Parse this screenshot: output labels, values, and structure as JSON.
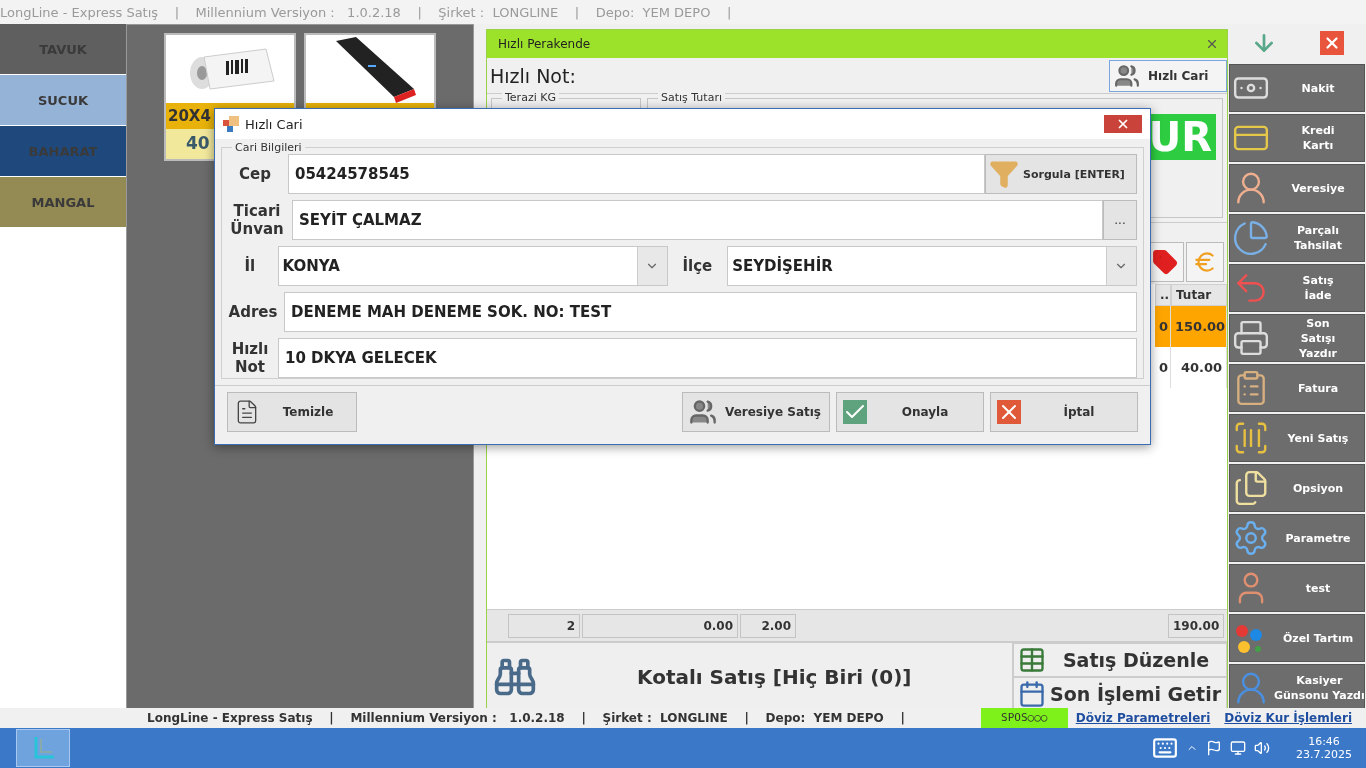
{
  "top_bar": {
    "text": "LongLine - Express Satış    |    Millennium Versiyon :   1.0.2.18    |    Şirket :  LONGLINE    |    Depo:  YEM DEPO    |"
  },
  "categories": [
    {
      "label": "TAVUK",
      "color": "#5f5f5f"
    },
    {
      "label": "SUCUK",
      "color": "#95b3d7"
    },
    {
      "label": "BAHARAT",
      "color": "#1f497d"
    },
    {
      "label": "MANGAL",
      "color": "#948a54"
    }
  ],
  "products": [
    {
      "kind": "label-roll",
      "name": "20X4",
      "price": "40"
    },
    {
      "kind": "powerbank"
    }
  ],
  "sale": {
    "tab_title": "Hızlı Perakende",
    "note_label": "Hızlı Not:",
    "quick_customer_button": "Hızlı Cari",
    "groups": [
      "Terazi KG",
      "Satış Tutarı"
    ],
    "amount_display": "UR",
    "table": {
      "columns": [
        "..",
        "Tutar"
      ],
      "rows": [
        {
          "cells": [
            "0",
            "150.00"
          ],
          "selected": true
        },
        {
          "cells": [
            "0",
            "40.00"
          ],
          "selected": false
        }
      ]
    },
    "totals": [
      "2",
      "0.00",
      "2.00",
      "190.00"
    ],
    "quota_button": "Kotalı Satış [Hiç Biri (0)]",
    "edit_button": "Satış Düzenle",
    "last_button": "Son İşlemi Getir"
  },
  "actions": [
    {
      "label": "Nakit",
      "kind": "register"
    },
    {
      "label": "Kredi\nKartı",
      "kind": "card"
    },
    {
      "label": "Veresiye",
      "kind": "person"
    },
    {
      "label": "Parçalı\nTahsilat",
      "kind": "split"
    },
    {
      "label": "Satış\nİade",
      "kind": "return"
    },
    {
      "label": "Son\nSatışı\nYazdır",
      "kind": "printer"
    },
    {
      "label": "Fatura",
      "kind": "invoice"
    },
    {
      "label": "Yeni Satış",
      "kind": "scanner"
    },
    {
      "label": "Opsiyon",
      "kind": "docs"
    },
    {
      "label": "Parametre",
      "kind": "settings"
    },
    {
      "label": "test",
      "kind": "user"
    },
    {
      "label": "Özel Tartım",
      "kind": "dots"
    },
    {
      "label": "Kasiyer\nGünsonu Yazdı",
      "kind": "cashier"
    }
  ],
  "dialog": {
    "title": "Hızlı Cari",
    "group": "Cari Bilgileri",
    "phone": {
      "label": "Cep",
      "value": "05424578545",
      "button": "Sorgula [ENTER]"
    },
    "company": {
      "label": "Ticari\nÜnvan",
      "value": "SEYİT ÇALMAZ",
      "button": "..."
    },
    "city": {
      "label": "İl",
      "value": "KONYA"
    },
    "district": {
      "label": "İlçe",
      "value": "SEYDİŞEHİR"
    },
    "address": {
      "label": "Adres",
      "value": "DENEME MAH DENEME SOK. NO: TEST"
    },
    "note": {
      "label": "Hızlı\nNot",
      "value": "10 DKYA GELECEK"
    },
    "buttons": [
      {
        "label": "Temizle",
        "kind": "clear"
      },
      {
        "label": "Veresiye Satış",
        "kind": "credit"
      },
      {
        "label": "Onayla",
        "kind": "confirm"
      },
      {
        "label": "İptal",
        "kind": "cancel"
      }
    ]
  },
  "status_bar": {
    "text": "LongLine - Express Satış    |    Millennium Versiyon :   1.0.2.18    |    Şirket :  LONGLINE    |    Depo:  YEM DEPO    |",
    "spos": "SPOS○○○",
    "links": [
      "Döviz Parametreleri",
      "Döviz Kur İşlemleri"
    ]
  },
  "taskbar": {
    "time": "16:46",
    "date": "23.7.2025"
  }
}
